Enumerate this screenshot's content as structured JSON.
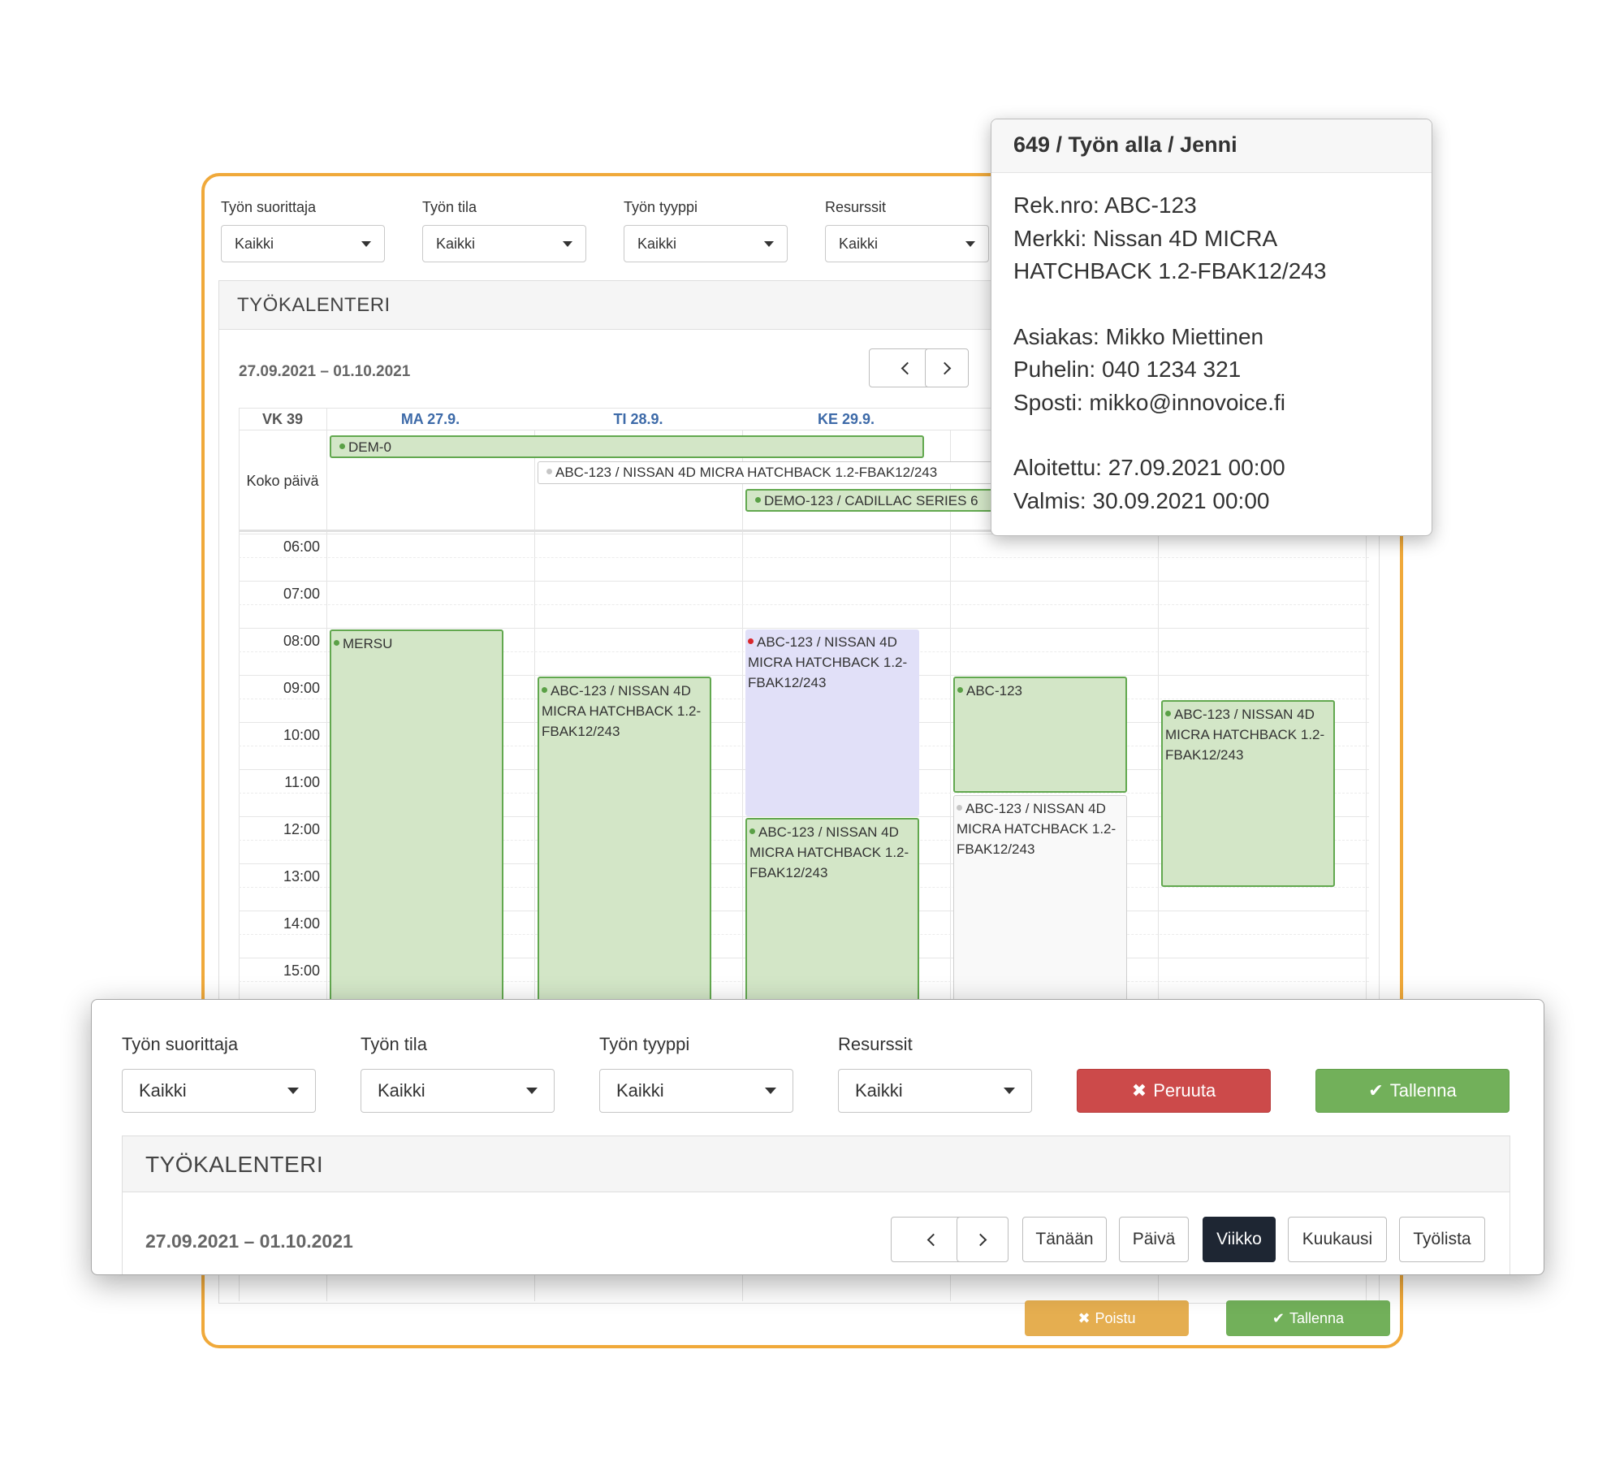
{
  "filters": {
    "performer_label": "Työn suorittaja",
    "status_label": "Työn tila",
    "type_label": "Työn tyyppi",
    "resources_label": "Resurssit",
    "performer_value": "Kaikki",
    "status_value": "Kaikki",
    "type_value": "Kaikki",
    "resources_value": "Kaikki"
  },
  "calendar": {
    "title": "TYÖKALENTERI",
    "date_range": "27.09.2021 – 01.10.2021",
    "week_label": "VK 39",
    "allday_label": "Koko päivä",
    "days": [
      "MA 27.9.",
      "TI 28.9.",
      "KE 29.9."
    ],
    "times": [
      "06:00",
      "07:00",
      "08:00",
      "09:00",
      "10:00",
      "11:00",
      "12:00",
      "13:00",
      "14:00",
      "15:00"
    ],
    "allday_events": [
      {
        "title": "DEM-0"
      },
      {
        "title": "ABC-123 / NISSAN 4D MICRA HATCHBACK 1.2-FBAK12/243"
      },
      {
        "title": "DEMO-123 / CADILLAC SERIES 6"
      }
    ],
    "events": [
      {
        "title": "MERSU"
      },
      {
        "title": "ABC-123 / NISSAN 4D MICRA HATCHBACK 1.2-FBAK12/243"
      },
      {
        "title": "ABC-123 / NISSAN 4D MICRA HATCHBACK 1.2-FBAK12/243"
      },
      {
        "title": "ABC-123 / NISSAN 4D MICRA HATCHBACK 1.2-FBAK12/243"
      },
      {
        "title": "ABC-123"
      },
      {
        "title": "ABC-123 / NISSAN 4D MICRA HATCHBACK 1.2-FBAK12/243"
      },
      {
        "title": "ABC-123 / NISSAN 4D MICRA HATCHBACK 1.2-FBAK12/243"
      }
    ]
  },
  "bg_footer": {
    "exit_label": "Poistu",
    "save_label": "Tallenna"
  },
  "front_panel": {
    "cancel_label": "Peruuta",
    "save_label": "Tallenna",
    "nav": {
      "today": "Tänään",
      "day": "Päivä",
      "week": "Viikko",
      "month": "Kuukausi",
      "worklist": "Työlista"
    }
  },
  "popover": {
    "title": "649 / Työn alla / Jenni",
    "reg": "Rek.nro: ABC-123",
    "brand_line1": "Merkki: Nissan 4D MICRA",
    "brand_line2": "HATCHBACK 1.2-FBAK12/243",
    "customer": "Asiakas: Mikko Miettinen",
    "phone": "Puhelin: 040 1234 321",
    "email": "Sposti: mikko@innovoice.fi",
    "started": "Aloitettu: 27.09.2021 00:00",
    "ready": "Valmis: 30.09.2021 00:00"
  },
  "colors": {
    "accent_border": "#f0a93a",
    "event_green": "#d3e6c7",
    "event_green_border": "#62a84f",
    "event_lavender": "#e1e0f8",
    "cancel_red": "#cc4a4a",
    "save_green": "#72b05a",
    "exit_orange": "#e5ae50",
    "active_dark": "#1e2633",
    "day_header_blue": "#3d6aa8"
  },
  "icons": [
    "chevron-left-icon",
    "chevron-right-icon",
    "caret-down-icon",
    "x-icon",
    "check-icon"
  ]
}
